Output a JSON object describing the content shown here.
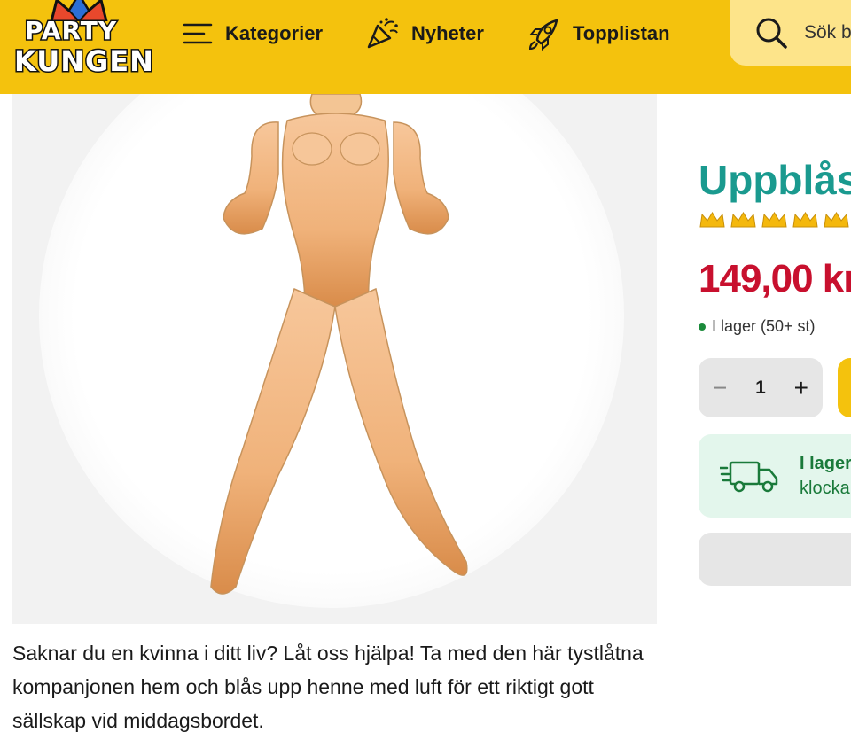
{
  "header": {
    "logo_line1": "PARTY",
    "logo_line2": "KUNGEN",
    "nav": [
      {
        "label": "Kategorier",
        "icon": "menu-icon"
      },
      {
        "label": "Nyheter",
        "icon": "party-popper-icon"
      },
      {
        "label": "Topplistan",
        "icon": "rocket-icon"
      }
    ],
    "search_placeholder": "Sök b"
  },
  "product": {
    "title": "Uppblås",
    "rating_icons": 5,
    "price": "149,00 kr",
    "stock_text": "I lager (50+ st)",
    "quantity": "1",
    "delivery_line1": "I lager",
    "delivery_line2": "klocka",
    "description": "Saknar du en kvinna i ditt liv? Låt oss hjälpa! Ta med den här tystlåtna kompanjonen hem och blås upp henne med luft för ett riktigt gott sällskap vid middagsbordet."
  },
  "colors": {
    "header": "#f4c20d",
    "title": "#1a9a8f",
    "price": "#c8102e",
    "stock_dot": "#1a8a3a",
    "delivery_bg": "#e3f6ec"
  }
}
